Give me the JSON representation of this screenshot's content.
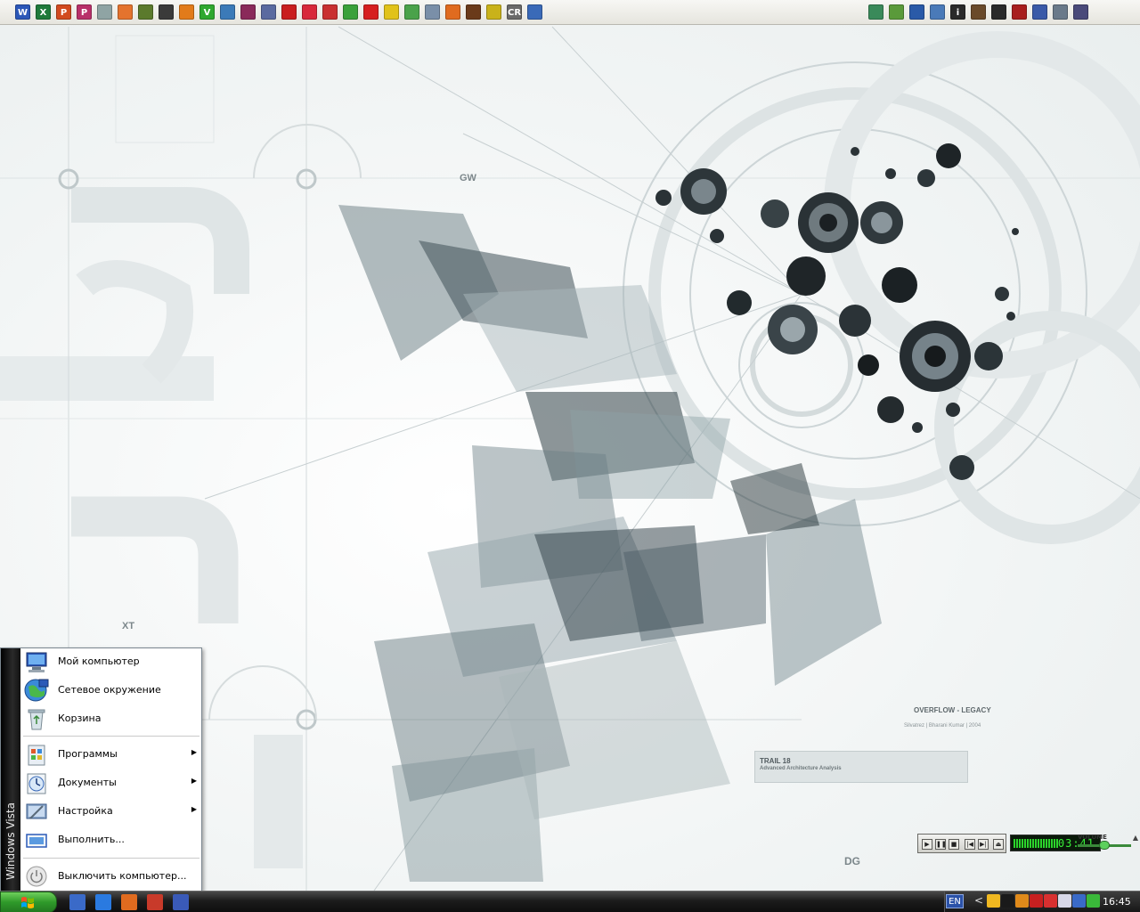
{
  "wallpaper": {
    "labels": {
      "gw": "GW",
      "xt": "XT",
      "dg": "DG",
      "overflow": "OVERFLOW - LEGACY",
      "credit": "Silvatrez | Bharani Kumar | 2004",
      "trail": "TRAIL 18",
      "trail_sub": "Advanced Architecture Analysis"
    }
  },
  "quick_launch": {
    "left_icons": [
      {
        "name": "word-icon",
        "glyph": "W",
        "color": "#2b57b8"
      },
      {
        "name": "excel-icon",
        "glyph": "X",
        "color": "#1f7a3a"
      },
      {
        "name": "powerpoint-icon",
        "glyph": "P",
        "color": "#d24a1f"
      },
      {
        "name": "publisher-icon",
        "glyph": "P",
        "color": "#b8306a"
      },
      {
        "name": "eraser-icon",
        "glyph": "",
        "color": "#8fa4a4"
      },
      {
        "name": "camera-icon",
        "glyph": "",
        "color": "#e4732e"
      },
      {
        "name": "image-viewer-icon",
        "glyph": "",
        "color": "#5b7a2c"
      },
      {
        "name": "terminal-icon",
        "glyph": "",
        "color": "#3a3a3a"
      },
      {
        "name": "media-icon",
        "glyph": "",
        "color": "#e27b1a"
      },
      {
        "name": "download-icon",
        "glyph": "V",
        "color": "#2fa82f"
      },
      {
        "name": "pen-icon",
        "glyph": "",
        "color": "#3b7ab8"
      },
      {
        "name": "archive-icon",
        "glyph": "",
        "color": "#8a2a5a"
      },
      {
        "name": "phone-icon",
        "glyph": "",
        "color": "#5a6aa0"
      },
      {
        "name": "opera-icon",
        "glyph": "",
        "color": "#c91e1e"
      },
      {
        "name": "lifebuoy-icon",
        "glyph": "",
        "color": "#d8283a"
      },
      {
        "name": "house-icon",
        "glyph": "",
        "color": "#c93030"
      },
      {
        "name": "globe-green-icon",
        "glyph": "",
        "color": "#3aa13a"
      },
      {
        "name": "red-square-icon",
        "glyph": "",
        "color": "#d61f1f"
      },
      {
        "name": "bug-icon",
        "glyph": "",
        "color": "#e1c21a"
      },
      {
        "name": "leaf-icon",
        "glyph": "",
        "color": "#4aa24a"
      },
      {
        "name": "compass-icon",
        "glyph": "",
        "color": "#7a8fa8"
      },
      {
        "name": "firefox-icon",
        "glyph": "",
        "color": "#e06b1f"
      },
      {
        "name": "disc-icon",
        "glyph": "",
        "color": "#6a3a1a"
      },
      {
        "name": "figure-icon",
        "glyph": "",
        "color": "#c9b21a"
      },
      {
        "name": "cr-icon",
        "glyph": "CR",
        "color": "#6a6a6a"
      },
      {
        "name": "network-icon",
        "glyph": "",
        "color": "#3a6ab8"
      }
    ],
    "right_icons": [
      {
        "name": "network-monitor-icon",
        "glyph": "",
        "color": "#3a8a5a"
      },
      {
        "name": "photo-icon",
        "glyph": "",
        "color": "#5a9a3a"
      },
      {
        "name": "screen-blue-icon",
        "glyph": "",
        "color": "#2a5aa8"
      },
      {
        "name": "wrench-icon",
        "glyph": "",
        "color": "#4a7ab8"
      },
      {
        "name": "info-icon",
        "glyph": "i",
        "color": "#2a2a2a"
      },
      {
        "name": "antenna-icon",
        "glyph": "",
        "color": "#6a4a2a"
      },
      {
        "name": "star-icon",
        "glyph": "",
        "color": "#2a2a2a"
      },
      {
        "name": "shield-icon",
        "glyph": "",
        "color": "#a81e1e"
      },
      {
        "name": "monitor-icon",
        "glyph": "",
        "color": "#3a5aa8"
      },
      {
        "name": "gear-icon",
        "glyph": "",
        "color": "#6a7a8a"
      },
      {
        "name": "fork-icon",
        "glyph": "",
        "color": "#4a4a7a"
      }
    ]
  },
  "start_menu": {
    "band_text": "Windows Vista",
    "items": [
      {
        "label": "Мой компьютер",
        "icon": "computer-icon",
        "submenu": false
      },
      {
        "label": "Сетевое окружение",
        "icon": "network-globe-icon",
        "submenu": false
      },
      {
        "label": "Корзина",
        "icon": "recycle-bin-icon",
        "submenu": false
      },
      {
        "label": "Программы",
        "icon": "programs-icon",
        "submenu": true
      },
      {
        "label": "Документы",
        "icon": "documents-icon",
        "submenu": true
      },
      {
        "label": "Настройка",
        "icon": "settings-icon",
        "submenu": true
      },
      {
        "label": "Выполнить...",
        "icon": "run-icon",
        "submenu": false
      },
      {
        "label": "Выключить компьютер...",
        "icon": "power-icon",
        "submenu": false
      }
    ],
    "submenu_arrow": "▶"
  },
  "media_player": {
    "time": "03:41",
    "volume_label": "VOLUME",
    "volume_level": 0.45,
    "controls": [
      "▶",
      "❚❚",
      "■",
      "|◀",
      "▶|",
      "⏏"
    ]
  },
  "taskbar": {
    "quick_launch": [
      {
        "name": "show-desktop-icon",
        "color": "#3a6ac8"
      },
      {
        "name": "internet-explorer-icon",
        "color": "#2a7ae0"
      },
      {
        "name": "firefox-icon",
        "color": "#e06b1f"
      },
      {
        "name": "app-red-icon",
        "color": "#c83a2a"
      },
      {
        "name": "save-floppy-icon",
        "color": "#3a5ab8"
      }
    ],
    "tray": {
      "lang": "EN",
      "chevron": "<",
      "icons": [
        {
          "name": "sun-icon",
          "color": "#f0b820"
        },
        {
          "name": "monitor-black-icon",
          "color": "#1a1a1a"
        },
        {
          "name": "player-arrow-icon",
          "color": "#e08a1a"
        },
        {
          "name": "sound-muted-icon",
          "color": "#c82020"
        },
        {
          "name": "kaspersky-icon",
          "color": "#d83030"
        },
        {
          "name": "globe-white-icon",
          "color": "#d8d8e8"
        },
        {
          "name": "disc-blue-icon",
          "color": "#3a6ac8"
        },
        {
          "name": "speaker-green-icon",
          "color": "#3ab83a"
        }
      ],
      "clock": "16:45"
    }
  }
}
